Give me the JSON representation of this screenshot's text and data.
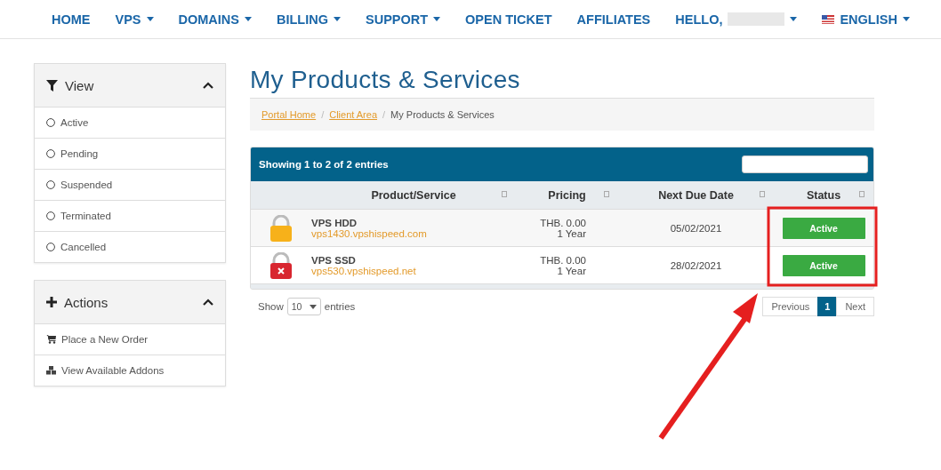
{
  "nav": {
    "items": [
      {
        "label": "HOME",
        "dropdown": false
      },
      {
        "label": "VPS",
        "dropdown": true
      },
      {
        "label": "DOMAINS",
        "dropdown": true
      },
      {
        "label": "BILLING",
        "dropdown": true
      },
      {
        "label": "SUPPORT",
        "dropdown": true
      },
      {
        "label": "OPEN TICKET",
        "dropdown": false
      },
      {
        "label": "AFFILIATES",
        "dropdown": false
      },
      {
        "label": "HELLO,",
        "dropdown": true,
        "kind": "user"
      },
      {
        "label": "ENGLISH",
        "dropdown": true,
        "kind": "language"
      }
    ]
  },
  "sidebar": {
    "panels": [
      {
        "title": "View",
        "kind": "filter",
        "expanded": true,
        "items": [
          {
            "label": "Active",
            "kind": "radio",
            "checked": false
          },
          {
            "label": "Pending",
            "kind": "radio",
            "checked": false
          },
          {
            "label": "Suspended",
            "kind": "radio",
            "checked": false
          },
          {
            "label": "Terminated",
            "kind": "radio",
            "checked": false
          },
          {
            "label": "Cancelled",
            "kind": "radio",
            "checked": false
          }
        ]
      },
      {
        "title": "Actions",
        "kind": "plus",
        "expanded": true,
        "items": [
          {
            "label": "Place a New Order",
            "kind": "cart"
          },
          {
            "label": "View Available Addons",
            "kind": "addons"
          }
        ]
      }
    ]
  },
  "page": {
    "title": "My Products & Services",
    "breadcrumb_separator": "/",
    "breadcrumb": [
      {
        "label": "Portal Home",
        "link": true
      },
      {
        "label": "Client Area",
        "link": true
      },
      {
        "label": "My Products & Services",
        "link": false
      }
    ]
  },
  "table": {
    "info": "Showing 1 to 2 of 2 entries",
    "columns": [
      "Product/Service",
      "Pricing",
      "Next Due Date",
      "Status"
    ],
    "rows": [
      {
        "kind": "lock",
        "product": "VPS HDD",
        "domain": "vps1430.vpshispeed.com",
        "price": "THB. 0.00",
        "cycle": "1 Year",
        "due": "05/02/2021",
        "status": "Active"
      },
      {
        "kind": "lock-cross",
        "product": "VPS SSD",
        "domain": "vps530.vpshispeed.net",
        "price": "THB. 0.00",
        "cycle": "1 Year",
        "due": "28/02/2021",
        "status": "Active"
      }
    ],
    "length": {
      "prefix": "Show",
      "value": "10",
      "suffix": "entries"
    },
    "pagination": [
      {
        "label": "Previous",
        "selected": false
      },
      {
        "label": "1",
        "selected": true
      },
      {
        "label": "Next",
        "selected": false
      }
    ]
  },
  "annotation": {
    "kind": "highlight-arrow"
  }
}
